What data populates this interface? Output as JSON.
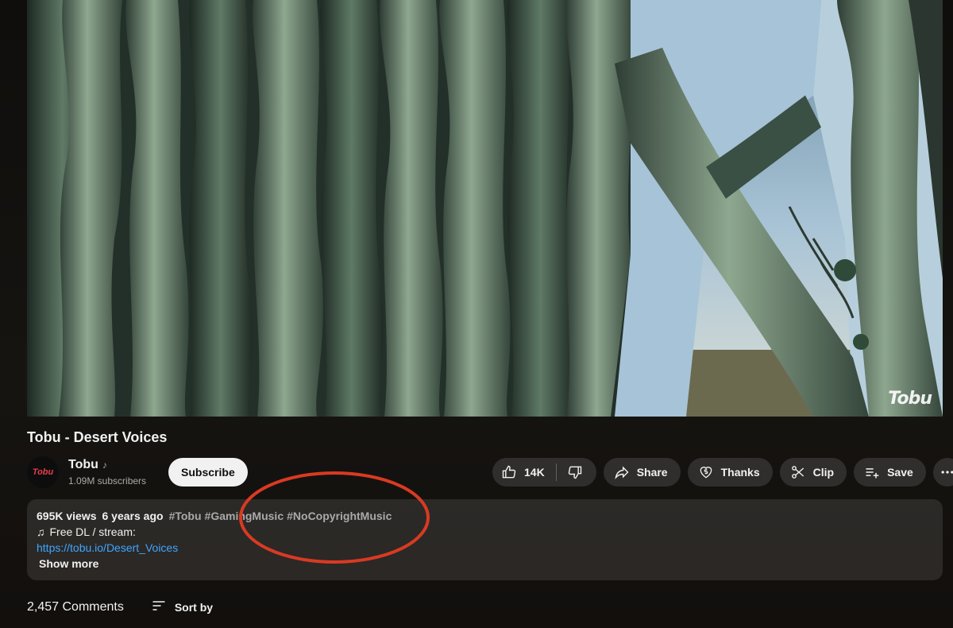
{
  "player": {
    "watermark": "Tobu"
  },
  "video": {
    "title": "Tobu - Desert Voices"
  },
  "channel": {
    "avatar_text": "Tobu",
    "name": "Tobu",
    "name_icon": "music-note-icon",
    "subscribers": "1.09M subscribers",
    "subscribe_label": "Subscribe"
  },
  "actions": {
    "like_count": "14K",
    "share_label": "Share",
    "thanks_label": "Thanks",
    "clip_label": "Clip",
    "save_label": "Save"
  },
  "description": {
    "views": "695K views",
    "age": "6 years ago",
    "tags": [
      "#Tobu",
      "#GamingMusic",
      "#NoCopyrightMusic"
    ],
    "line2_icon": "music-note-icon",
    "line2_text": "Free DL / stream:",
    "link": "https://tobu.io/Desert_Voices",
    "show_more": "Show more"
  },
  "comments": {
    "count": "2,457 Comments",
    "sort_label": "Sort by"
  },
  "colors": {
    "annotation": "#d93a22",
    "link": "#3ea6ff",
    "tag": "#aaaaaa"
  }
}
